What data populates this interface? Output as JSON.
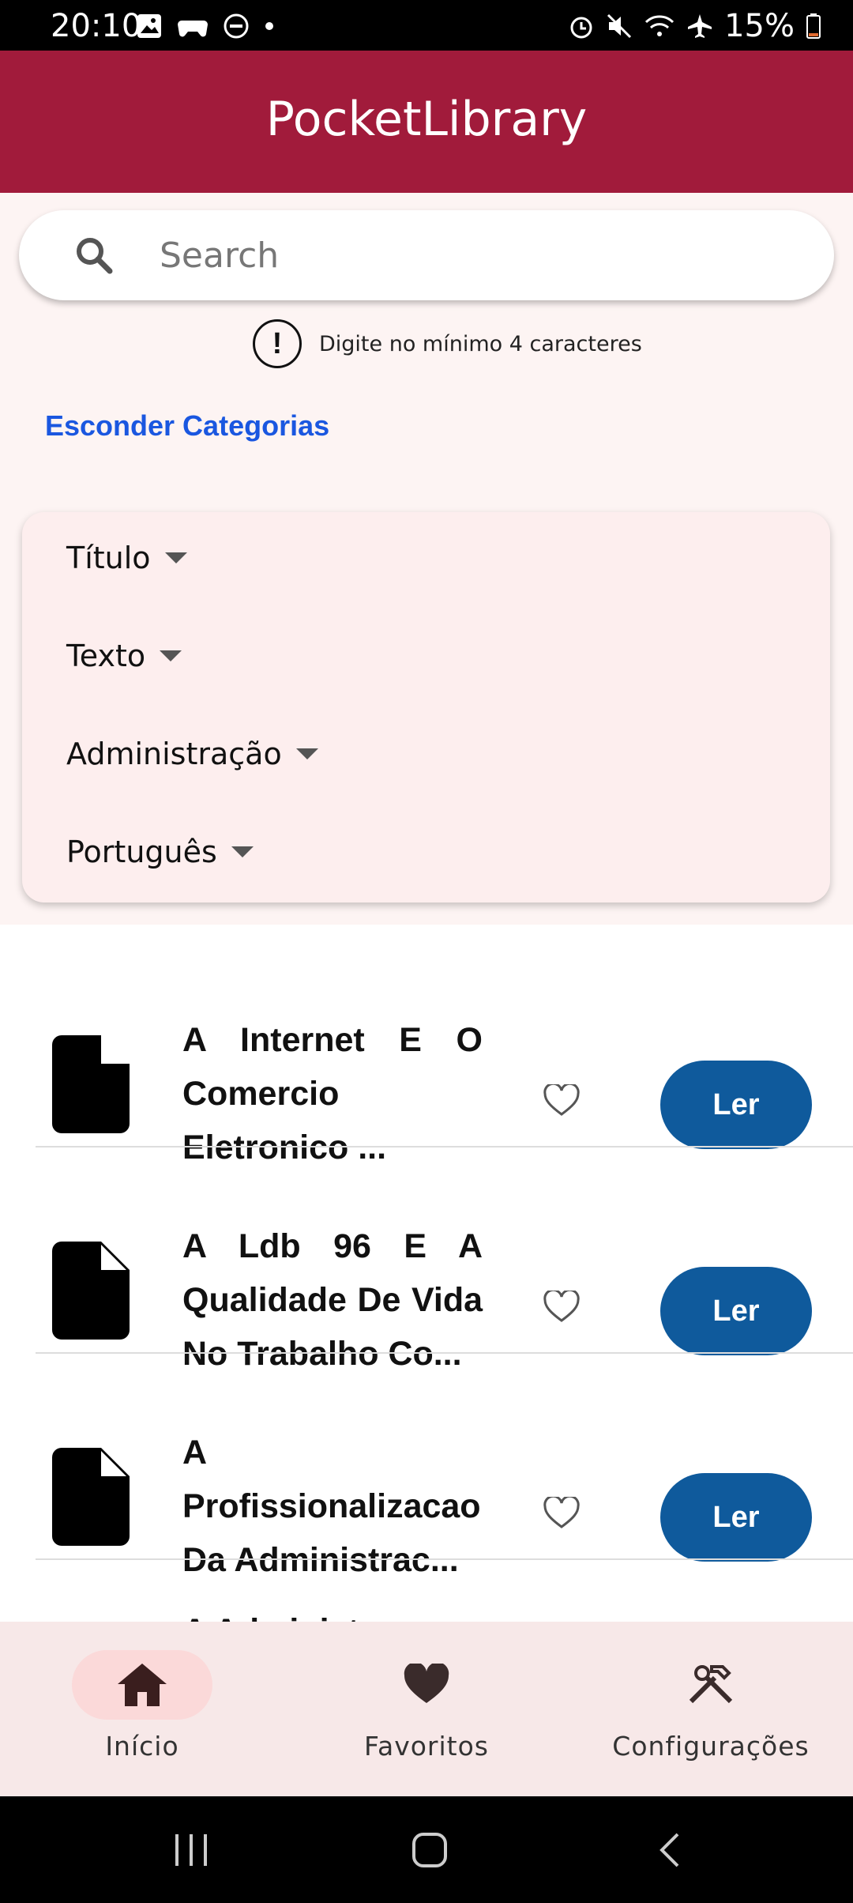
{
  "status_bar": {
    "time": "20:10",
    "battery": "15%"
  },
  "app_bar": {
    "title": "PocketLibrary"
  },
  "search": {
    "placeholder": "Search",
    "hint": "Digite no mínimo 4 caracteres"
  },
  "categories": {
    "toggle_label": "Esconder Categorias",
    "filters": [
      "Título",
      "Texto",
      "Administração",
      "Português"
    ]
  },
  "books": [
    {
      "title": "A Internet E O Comercio Eletronico ...",
      "action": "Ler"
    },
    {
      "title": "A Ldb 96 E A Qualidade De Vida No Trabalho Co...",
      "action": "Ler"
    },
    {
      "title": "A Profissionalizacao Da Administrac...",
      "action": "Ler"
    }
  ],
  "partial_row": {
    "title_fragment": "A Administ"
  },
  "bottom_nav": {
    "items": [
      {
        "label": "Início",
        "icon": "home-icon",
        "active": true
      },
      {
        "label": "Favoritos",
        "icon": "heart-icon",
        "active": false
      },
      {
        "label": "Configurações",
        "icon": "tools-icon",
        "active": false
      }
    ]
  },
  "colors": {
    "app_bar": "#A11B3B",
    "link": "#1A57E0",
    "read_button": "#0F5A9C",
    "nav_bg": "#F7E8E8",
    "nav_active_pill": "#FBD9D9"
  }
}
